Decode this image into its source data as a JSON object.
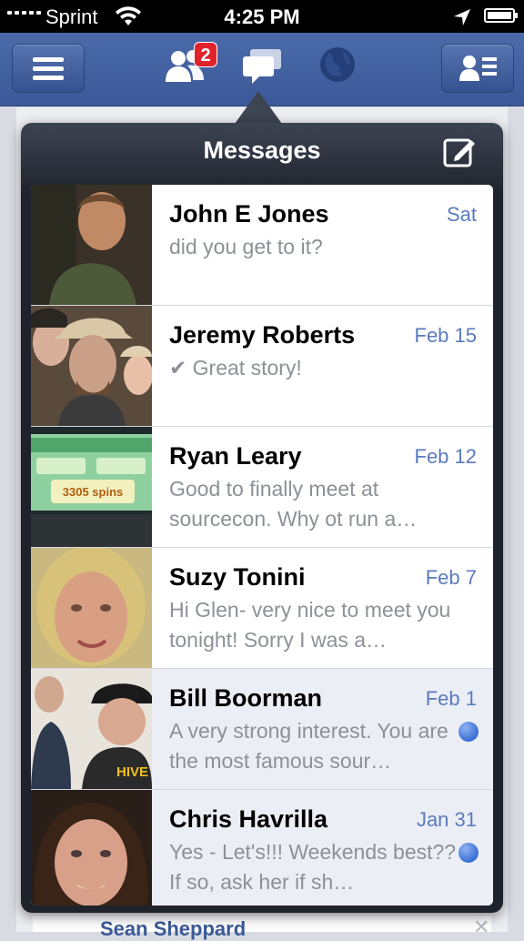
{
  "status_bar": {
    "carrier": "Sprint",
    "time": "4:25 PM"
  },
  "nav": {
    "friend_requests_badge": "2"
  },
  "popover": {
    "title": "Messages"
  },
  "messages": [
    {
      "name": "John E Jones",
      "date": "Sat",
      "snippet": "did you get to it?",
      "unread": false,
      "replied": false
    },
    {
      "name": "Jeremy Roberts",
      "date": "Feb 15",
      "snippet": "Great story!",
      "unread": false,
      "replied": true
    },
    {
      "name": "Ryan Leary",
      "date": "Feb 12",
      "snippet": "Good to finally meet at sourcecon. Why ot run a…",
      "unread": false,
      "replied": false
    },
    {
      "name": "Suzy Tonini",
      "date": "Feb 7",
      "snippet": "Hi Glen- very nice to meet you tonight! Sorry I was a…",
      "unread": false,
      "replied": false
    },
    {
      "name": "Bill Boorman",
      "date": "Feb 1",
      "snippet": "A very strong interest. You are the most famous sour…",
      "unread": true,
      "replied": false
    },
    {
      "name": "Chris Havrilla",
      "date": "Jan 31",
      "snippet": "Yes - Let's!!!  Weekends best??  If so, ask her if sh…",
      "unread": true,
      "replied": false
    }
  ],
  "background": {
    "bottom_name": "Sean Sheppard"
  }
}
